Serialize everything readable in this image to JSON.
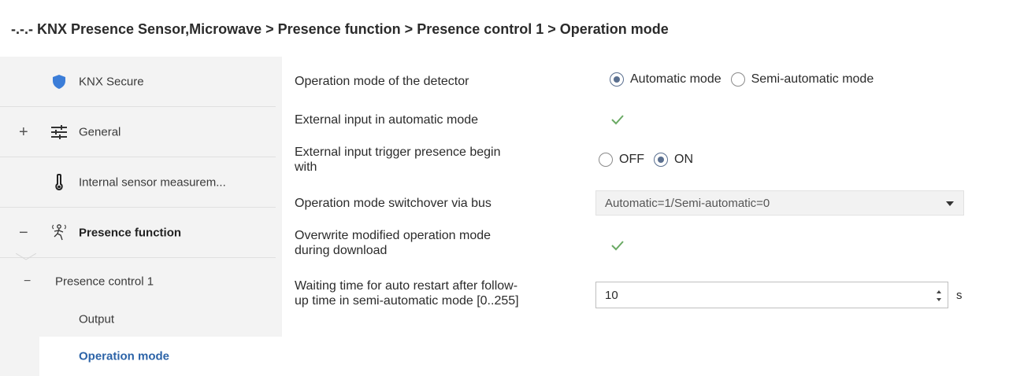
{
  "window": {
    "breadcrumb": "-.-.- KNX Presence Sensor,Microwave > Presence function > Presence control 1 > Operation mode"
  },
  "sidebar": {
    "items": [
      {
        "label": "KNX Secure",
        "icon": "shield-icon",
        "expander": ""
      },
      {
        "label": "General",
        "icon": "sliders-icon",
        "expander": "+"
      },
      {
        "label": "Internal sensor measurem...",
        "icon": "thermometer-icon",
        "expander": ""
      },
      {
        "label": "Presence function",
        "icon": "person-walking-icon",
        "expander": "−"
      }
    ],
    "sub": {
      "group_label": "Presence control 1",
      "group_expander": "−",
      "output_label": "Output",
      "selected_label": "Operation mode"
    }
  },
  "params": {
    "op_mode": {
      "label": "Operation mode of the detector",
      "options": [
        "Automatic mode",
        "Semi-automatic mode"
      ],
      "selected": "Automatic mode"
    },
    "ext_input": {
      "label": "External input in automatic mode",
      "checked": true
    },
    "ext_trigger": {
      "label_line1": "External input trigger presence begin",
      "label_line2": "with",
      "options": [
        "OFF",
        "ON"
      ],
      "selected": "ON"
    },
    "switchover": {
      "label": "Operation mode switchover via bus",
      "value": "Automatic=1/Semi-automatic=0"
    },
    "overwrite": {
      "label_line1": "Overwrite modified operation mode",
      "label_line2": "during download",
      "checked": true
    },
    "waiting": {
      "label_line1": "Waiting time for auto restart after follow-",
      "label_line2": "up time in semi-automatic mode [0..255]",
      "value": "10",
      "unit": "s"
    }
  },
  "colors": {
    "accent_blue": "#2d64a8",
    "shield_blue": "#3b7dd8",
    "check_green": "#6aaa64",
    "sidebar_bg": "#f3f3f3"
  }
}
